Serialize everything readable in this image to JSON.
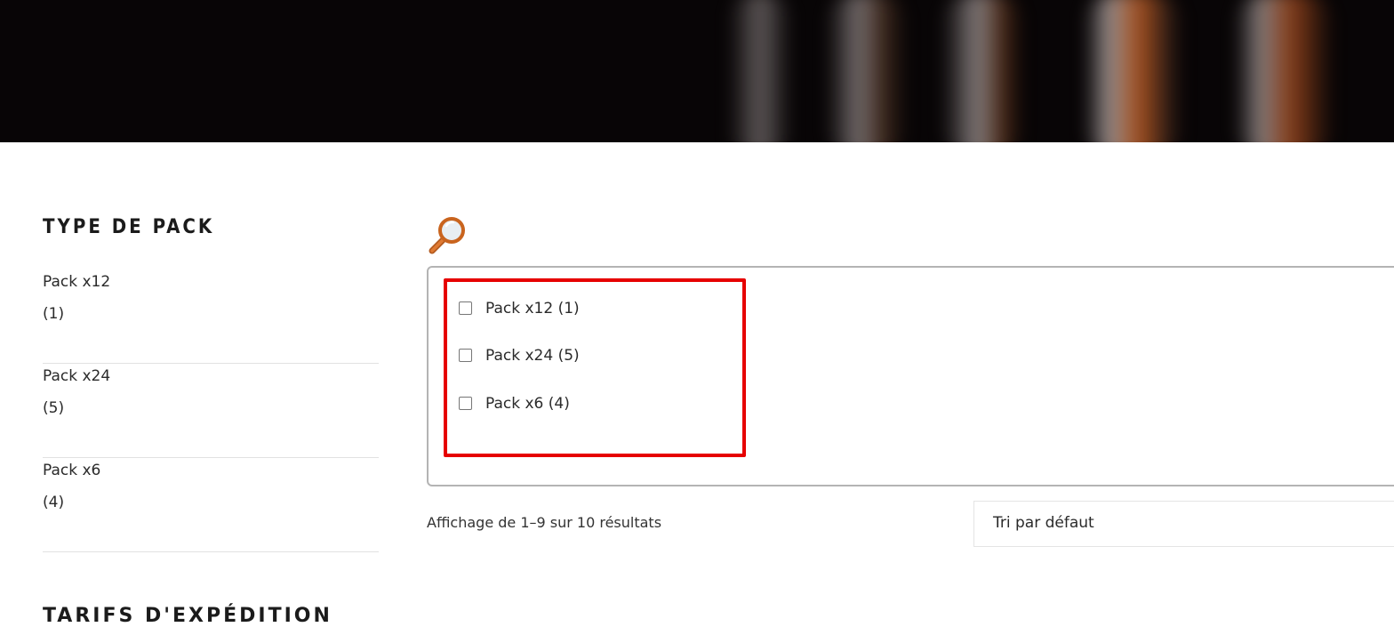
{
  "sidebar": {
    "title": "TYPE DE PACK",
    "items": [
      {
        "name": "Pack x12",
        "count": "(1)"
      },
      {
        "name": "Pack x24",
        "count": "(5)"
      },
      {
        "name": "Pack x6",
        "count": "(4)"
      }
    ],
    "next_section_title": "TARIFS D'EXPÉDITION"
  },
  "filter": {
    "icon": "search-icon",
    "options": [
      {
        "label": "Pack x12 (1)",
        "checked": false
      },
      {
        "label": "Pack x24 (5)",
        "checked": false
      },
      {
        "label": "Pack x6 (4)",
        "checked": false
      }
    ],
    "highlight_color": "#e60000"
  },
  "results": {
    "summary": "Affichage de 1–9 sur 10 résultats"
  },
  "sort": {
    "selected": "Tri par défaut"
  }
}
